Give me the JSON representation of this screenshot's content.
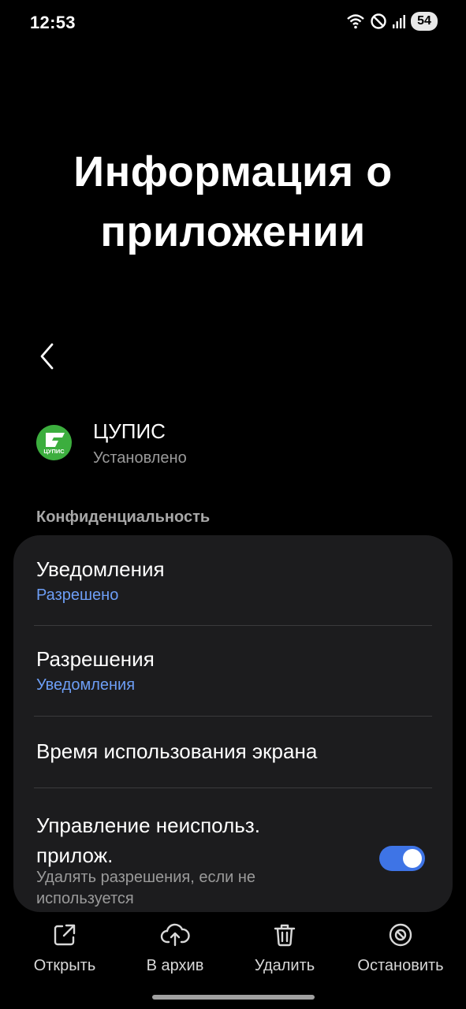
{
  "status_bar": {
    "time": "12:53",
    "battery": "54"
  },
  "page": {
    "title": "Информация о приложении"
  },
  "app": {
    "name": "ЦУПИС",
    "status": "Установлено",
    "icon_text": "ЦУПИС",
    "icon_color": "#3cae3e"
  },
  "section": {
    "title": "Конфиденциальность"
  },
  "settings": [
    {
      "title": "Уведомления",
      "subtitle": "Разрешено"
    },
    {
      "title": "Разрешения",
      "subtitle": "Уведомления"
    },
    {
      "title": "Время использования экрана"
    },
    {
      "title": "Управление неиспольз. прилож.",
      "subtitle": "Удалять разрешения, если не используется",
      "toggle_on": true
    }
  ],
  "actions": [
    {
      "label": "Открыть",
      "icon": "open-external-icon"
    },
    {
      "label": "В архив",
      "icon": "cloud-upload-icon"
    },
    {
      "label": "Удалить",
      "icon": "trash-icon"
    },
    {
      "label": "Остановить",
      "icon": "stop-icon"
    }
  ],
  "colors": {
    "accent": "#6d9ef6",
    "toggle": "#3e74e6",
    "card": "#1c1c1e"
  }
}
